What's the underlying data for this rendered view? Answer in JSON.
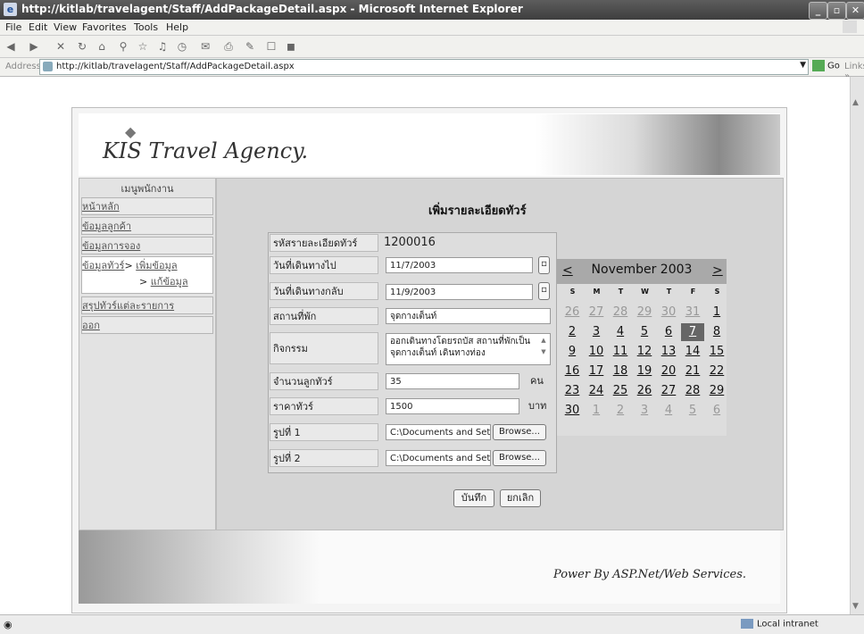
{
  "window": {
    "title": "http://kitlab/travelagent/Staff/AddPackageDetail.aspx - Microsoft Internet Explorer",
    "icon": "ie-icon",
    "controls": [
      "_",
      "▫",
      "✕"
    ]
  },
  "menu": [
    "File",
    "Edit",
    "View",
    "Favorites",
    "Tools",
    "Help"
  ],
  "address": {
    "label": "Address",
    "url": "http://kitlab/travelagent/Staff/AddPackageDetail.aspx",
    "go": "Go",
    "links": "Links »"
  },
  "site": {
    "brand": "KIS Travel Agency.",
    "footer": "Power By ASP.Net/Web Services."
  },
  "sidebar": {
    "title": "เมนูพนักงาน",
    "items": [
      {
        "label": "หน้าหลัก"
      },
      {
        "label": "ข้อมูลลูกค้า"
      },
      {
        "label": "ข้อมูลการจอง"
      },
      {
        "label": "ข้อมูลทัวร์",
        "sep": "> ",
        "sub1": "เพิ่มข้อมูล",
        "sub2": "แก้ข้อมูล"
      },
      {
        "label": "สรุปทัวร์แต่ละรายการ"
      },
      {
        "label": "ออก"
      }
    ]
  },
  "form": {
    "title": "เพิ่มรายละเอียดทัวร์",
    "id_label": "รหัสรายละเอียดทัวร์",
    "id_value": "1200016",
    "depart_label": "วันที่เดินทางไป",
    "depart_value": "11/7/2003",
    "return_label": "วันที่เดินทางกลับ",
    "return_value": "11/9/2003",
    "lodging_label": "สถานที่พัก",
    "lodging_value": "จุดกางเต็นท์",
    "activity_label": "กิจกรรม",
    "activity_value": "ออกเดินทางโดยรถบัส สถานที่พักเป็นจุดกางเต็นท์ เดินทางท่อง",
    "tourists_label": "จำนวนลูกทัวร์",
    "tourists_value": "35",
    "tourists_unit": "คน",
    "price_label": "ราคาทัวร์",
    "price_value": "1500",
    "price_unit": "บาท",
    "pic1_label": "รูปที่ 1",
    "pic1_value": "C:\\Documents and Settings",
    "pic2_label": "รูปที่ 2",
    "pic2_value": "C:\\Documents and Settings",
    "browse": "Browse...",
    "save": "บันทึก",
    "cancel": "ยกเลิก"
  },
  "calendar": {
    "prev": "<",
    "next": ">",
    "month": "November 2003",
    "dow": [
      "S",
      "M",
      "T",
      "W",
      "T",
      "F",
      "S"
    ],
    "weeks": [
      [
        {
          "d": "26",
          "o": true
        },
        {
          "d": "27",
          "o": true
        },
        {
          "d": "28",
          "o": true
        },
        {
          "d": "29",
          "o": true
        },
        {
          "d": "30",
          "o": true
        },
        {
          "d": "31",
          "o": true
        },
        {
          "d": "1"
        }
      ],
      [
        {
          "d": "2"
        },
        {
          "d": "3"
        },
        {
          "d": "4"
        },
        {
          "d": "5"
        },
        {
          "d": "6"
        },
        {
          "d": "7",
          "s": true
        },
        {
          "d": "8"
        }
      ],
      [
        {
          "d": "9"
        },
        {
          "d": "10"
        },
        {
          "d": "11"
        },
        {
          "d": "12"
        },
        {
          "d": "13"
        },
        {
          "d": "14"
        },
        {
          "d": "15"
        }
      ],
      [
        {
          "d": "16"
        },
        {
          "d": "17"
        },
        {
          "d": "18"
        },
        {
          "d": "19"
        },
        {
          "d": "20"
        },
        {
          "d": "21"
        },
        {
          "d": "22"
        }
      ],
      [
        {
          "d": "23"
        },
        {
          "d": "24"
        },
        {
          "d": "25"
        },
        {
          "d": "26"
        },
        {
          "d": "27"
        },
        {
          "d": "28"
        },
        {
          "d": "29"
        }
      ],
      [
        {
          "d": "30"
        },
        {
          "d": "1",
          "o": true
        },
        {
          "d": "2",
          "o": true
        },
        {
          "d": "3",
          "o": true
        },
        {
          "d": "4",
          "o": true
        },
        {
          "d": "5",
          "o": true
        },
        {
          "d": "6",
          "o": true
        }
      ]
    ]
  },
  "status": {
    "zone": "Local intranet"
  }
}
